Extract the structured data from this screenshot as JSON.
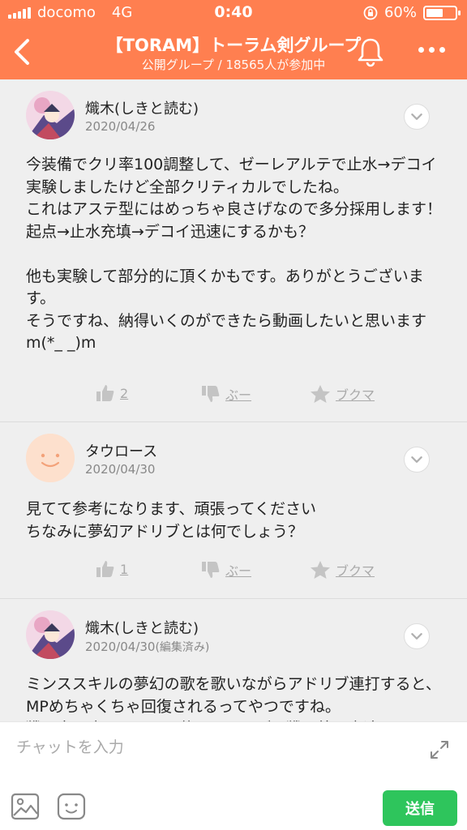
{
  "status_bar": {
    "carrier": "docomo",
    "network": "4G",
    "time": "0:40",
    "battery_percent": "60%",
    "battery_level": 0.6
  },
  "header": {
    "back_icon": "chevron-left-icon",
    "title": "【TORAM】トーラム剣グループ",
    "subtitle": "公開グループ / 18565人が参加中",
    "bell_icon": "bell-icon",
    "more_icon": "more-horizontal-icon",
    "background_color": "#ff7f50"
  },
  "posts": [
    {
      "author": "熾木(しきと読む)",
      "date": "2020/04/26",
      "edited": "",
      "body": "今装備でクリ率100調整して、ゼーレアルテで止水→デコイ実験しましたけど全部クリティカルでしたね。\nこれはアステ型にはめっちゃ良さげなので多分採用します！\n起点→止水充填→デコイ迅速にするかも？\n\n他も実験して部分的に頂くかもです。ありがとうございます。\nそうですね、納得いくのができたら動画したいと思いますm(*_ _)m",
      "like_count": "2",
      "boo_label": "ぶー",
      "bookmark_label": "ブクマ"
    },
    {
      "author": "タウロース",
      "date": "2020/04/30",
      "edited": "",
      "body": "見てて参考になります、頑張ってください\nちなみに夢幻アドリブとは何でしょう？",
      "like_count": "1",
      "boo_label": "ぶー",
      "bookmark_label": "ブクマ"
    },
    {
      "author": "熾木(しきと読む)",
      "date": "2020/04/30",
      "edited": "(編集済み)",
      "body": "ミンススキルの夢幻の歌を歌いながらアドリブ連打すると、MPめちゃくちゃ回復されるってやつですね。\n戦闘中は止まるしては使えませんが、戦闘外で高速MP"
    }
  ],
  "input": {
    "placeholder": "チャットを入力",
    "send_label": "送信",
    "send_color": "#2ec55c",
    "image_icon": "image-icon",
    "emoji_icon": "emoji-icon",
    "expand_icon": "expand-icon"
  }
}
